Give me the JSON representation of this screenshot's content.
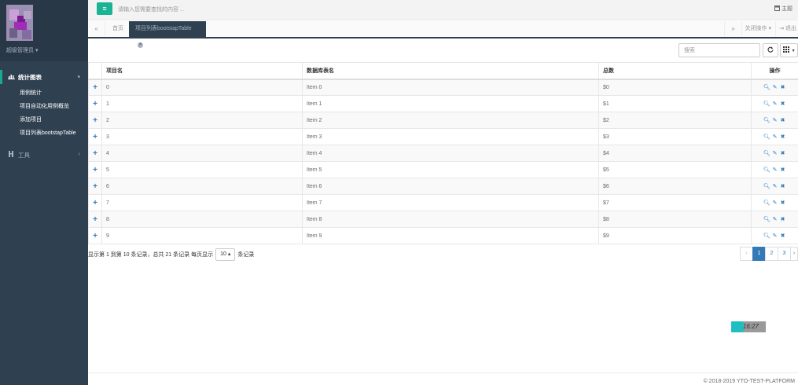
{
  "colors": {
    "sidebar_bg": "#2f4050",
    "accent": "#1ab394",
    "link": "#337ab7",
    "active_tab": "#2f4050"
  },
  "sidebar": {
    "user_name": "超级管理员 ▾",
    "groups": [
      {
        "icon": "bar-chart-icon",
        "label": "统计图表",
        "arrow": "▾",
        "items": [
          "用例统计",
          "项目自动化用例概览",
          "添加项目",
          "项目列表bootstapTable"
        ]
      },
      {
        "icon": "tools-icon",
        "label": "工具",
        "arrow": "‹"
      }
    ]
  },
  "topbar": {
    "menu_icon": "≡",
    "search_placeholder": "请输入您需要查找的内容 ...",
    "theme_label": "主题"
  },
  "tabs": {
    "home": "首页",
    "active": "项目列表bootstapTable",
    "close_ops": "关闭操作 ▾",
    "logout": "退出"
  },
  "table": {
    "search_placeholder": "搜索",
    "columns": [
      "项目名",
      "数据库表名",
      "总数",
      "操作"
    ],
    "rows": [
      {
        "name": "0",
        "table": "Item 0",
        "total": "$0"
      },
      {
        "name": "1",
        "table": "Item 1",
        "total": "$1"
      },
      {
        "name": "2",
        "table": "Item 2",
        "total": "$2"
      },
      {
        "name": "3",
        "table": "Item 3",
        "total": "$3"
      },
      {
        "name": "4",
        "table": "Item 4",
        "total": "$4"
      },
      {
        "name": "5",
        "table": "Item 5",
        "total": "$5"
      },
      {
        "name": "6",
        "table": "Item 6",
        "total": "$6"
      },
      {
        "name": "7",
        "table": "Item 7",
        "total": "$7"
      },
      {
        "name": "8",
        "table": "Item 8",
        "total": "$8"
      },
      {
        "name": "9",
        "table": "Item 9",
        "total": "$9"
      }
    ]
  },
  "pager": {
    "info_prefix": "显示第 1 到第 10 条记录，总共 21 条记录 每页显示",
    "page_size": "10 ▴",
    "info_suffix": "条记录",
    "prev": "‹",
    "pages": [
      "1",
      "2",
      "3"
    ],
    "next": "›",
    "active_page": "1"
  },
  "clock": "16:27",
  "footer": {
    "copyright": "© 2018-2019 YTO-TEST-PLATFORM"
  }
}
